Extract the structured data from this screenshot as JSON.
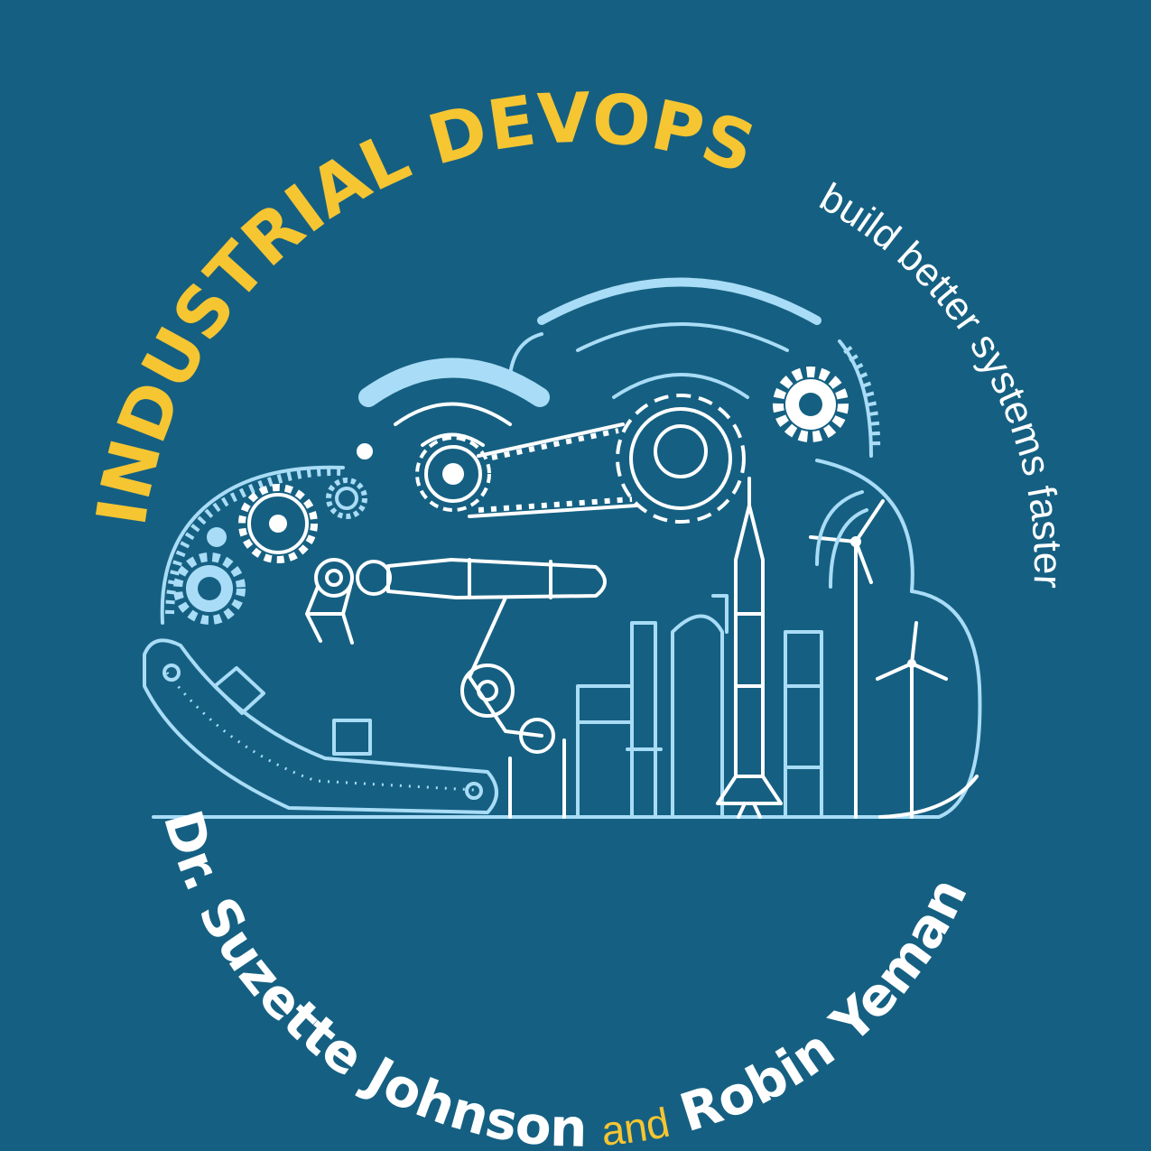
{
  "cover": {
    "title": "INDUSTRIAL DEVOPS",
    "tagline": "build better systems faster",
    "author_1": "Dr. Suzette Johnson",
    "conjunction": "and",
    "author_2": "Robin Yeman"
  },
  "colors": {
    "background": "#156082",
    "title": "#f6c532",
    "line_art": "#a9dcf6",
    "text": "#ffffff"
  },
  "icons": [
    "cloud-outline-icon",
    "wifi-signal-icon",
    "gear-icon",
    "chain-belt-icon",
    "robotic-arm-icon",
    "conveyor-belt-icon",
    "box-icon",
    "refinery-tower-icon",
    "storage-tank-icon",
    "rocket-icon",
    "wind-turbine-icon"
  ]
}
